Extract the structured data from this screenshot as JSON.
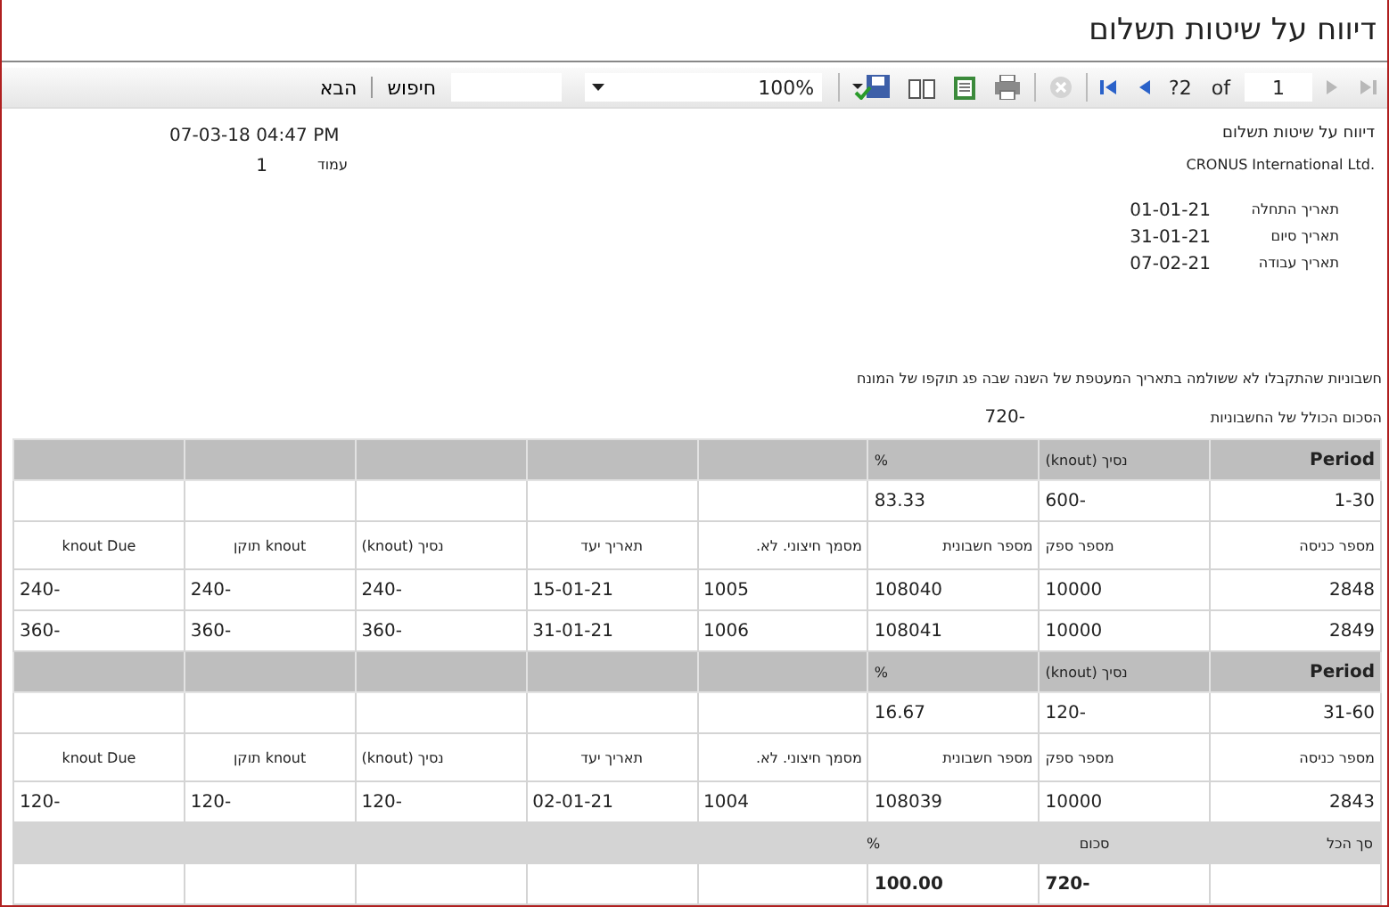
{
  "window": {
    "title": "דיווח על שיטות תשלום"
  },
  "toolbar": {
    "nav": [
      {
        "kind": "first",
        "disabled": true
      },
      {
        "kind": "prev",
        "disabled": true
      }
    ],
    "page": "1",
    "of": "of",
    "total": "2?",
    "nav2": [
      {
        "kind": "next",
        "disabled": false
      },
      {
        "kind": "last",
        "disabled": false
      }
    ],
    "stop_disabled": true,
    "zoom": "100%",
    "find": "חיפוש",
    "next": "הבא"
  },
  "report": {
    "title": "דיווח על שיטות תשלום",
    "company": "CRONUS International Ltd.",
    "dates": [
      {
        "label": "תאריך התחלה",
        "value": "01-01-21"
      },
      {
        "label": "תאריך סיום",
        "value": "31-01-21"
      },
      {
        "label": "תאריך עבודה",
        "value": "07-02-21"
      }
    ],
    "printed": "07-03-18 04:47 PM",
    "page_label": "עמוד",
    "page": "1",
    "description": "חשבוניות שהתקבלו לא ששולמה בתאריך המעטפת של השנה שבה פג תוקפו של המונח",
    "total_label": "הסכום הכולל של החשבוניות",
    "total": "-720"
  },
  "table": {
    "groups": [
      {
        "header": [
          "Period",
          "נסיך (knout)",
          "%"
        ],
        "values": [
          "1-30",
          "-600",
          "83.33"
        ],
        "columns": [
          "מספר כניסה",
          "מספר ספק",
          "מספר חשבונית",
          "מסמך חיצוני. לא.",
          "תאריך יעד",
          "נסיך (knout)",
          "knout תוקן",
          "knout Due"
        ],
        "rows": [
          [
            "2848",
            "10000",
            "108040",
            "1005",
            "15-01-21",
            "-240",
            "-240",
            "-240"
          ],
          [
            "2849",
            "10000",
            "108041",
            "1006",
            "31-01-21",
            "-360",
            "-360",
            "-360"
          ]
        ]
      },
      {
        "header": [
          "Period",
          "נסיך (knout)",
          "%"
        ],
        "values": [
          "31-60",
          "-120",
          "16.67"
        ],
        "columns": [
          "מספר כניסה",
          "מספר ספק",
          "מספר חשבונית",
          "מסמך חיצוני. לא.",
          "תאריך יעד",
          "נסיך (knout)",
          "knout תוקן",
          "knout Due"
        ],
        "rows": [
          [
            "2843",
            "10000",
            "108039",
            "1004",
            "02-01-21",
            "-120",
            "-120",
            "-120"
          ]
        ]
      }
    ],
    "totals": {
      "header": [
        "סך הכל",
        "סכום",
        "%"
      ],
      "values": [
        "-720",
        "100.00"
      ]
    }
  }
}
